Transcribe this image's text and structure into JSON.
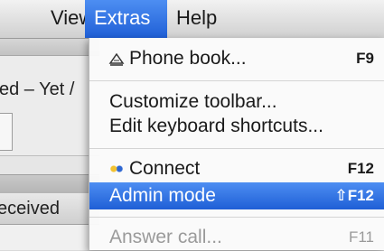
{
  "menubar": {
    "items": [
      {
        "label": "View"
      },
      {
        "label": "Extras"
      },
      {
        "label": "Help"
      }
    ]
  },
  "background_window": {
    "panel_title": "ed – Yet /",
    "received_tab": "eceived"
  },
  "extras_menu": {
    "items": [
      {
        "label": "Phone book...",
        "shortcut": "F9",
        "icon": "phone-book-icon"
      },
      {
        "label": "Customize toolbar..."
      },
      {
        "label": "Edit keyboard shortcuts..."
      },
      {
        "label": "Connect",
        "shortcut": "F12",
        "icon": "connect-icon"
      },
      {
        "label": "Admin mode",
        "shortcut": "⇧F12",
        "state": "highlighted"
      },
      {
        "label": "Answer call...",
        "shortcut": "F11",
        "state": "disabled"
      }
    ]
  },
  "colors": {
    "highlight": "#1f5fd6",
    "disabled_text": "#9a9a9a"
  }
}
